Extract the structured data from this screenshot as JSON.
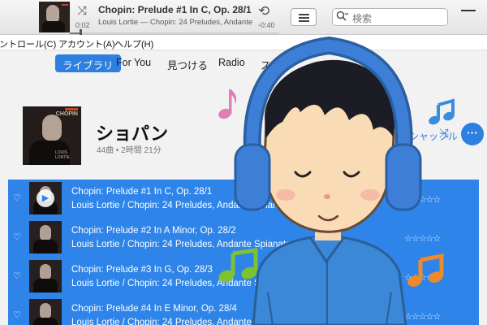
{
  "player": {
    "title": "Chopin: Prelude #1 In C, Op. 28/1",
    "subtitle": "Louis Lortie — Chopin: 24 Preludes, Andante Spianato",
    "elapsed": "0:02",
    "remaining": "-0:40",
    "progress_fraction": 0.05,
    "shuffle_icon": "⤨",
    "repeat_icon": "⟲"
  },
  "search": {
    "placeholder": "検索",
    "icon": "magnifier"
  },
  "menubar": {
    "items": [
      "コントロール(C)",
      "アカウント(A)",
      "ヘルプ(H)"
    ]
  },
  "nav": {
    "tabs": [
      {
        "label": "ライブラリ",
        "active": true
      },
      {
        "label": "For You",
        "active": false
      },
      {
        "label": "見つける",
        "active": false
      },
      {
        "label": "Radio",
        "active": false
      },
      {
        "label": "ストア",
        "active": false
      }
    ]
  },
  "album": {
    "title": "ショパン",
    "meta": "44曲 • 2時間 21分",
    "shuffle_label": "シャッフル",
    "art_text": "CHOPIN",
    "art_caption": "LOUIS LORTIE",
    "more_label": "···"
  },
  "tracks": [
    {
      "title": "Chopin: Prelude #1 In C, Op. 28/1",
      "subtitle": "Louis Lortie / Chopin: 24 Preludes, Andante Spianato",
      "playing": true,
      "stars": "☆☆☆☆☆"
    },
    {
      "title": "Chopin: Prelude #2 In A Minor, Op. 28/2",
      "subtitle": "Louis Lortie / Chopin: 24 Preludes, Andante Spianato, Etc",
      "playing": false,
      "stars": "☆☆☆☆☆"
    },
    {
      "title": "Chopin: Prelude #3 In G, Op. 28/3",
      "subtitle": "Louis Lortie / Chopin: 24 Preludes, Andante Spianato",
      "playing": false,
      "stars": "☆☆☆☆☆"
    },
    {
      "title": "Chopin: Prelude #4 In E Minor, Op. 28/4",
      "subtitle": "Louis Lortie / Chopin: 24 Preludes, Andante Spianato",
      "playing": false,
      "stars": "☆☆☆☆☆"
    }
  ],
  "colors": {
    "accent": "#2d7fe0",
    "selection": "#2e84e8",
    "headphones": "#3d7fd6",
    "note_pink": "#e07fb6",
    "note_blue": "#3a8ddd",
    "note_green": "#7cc231",
    "note_orange": "#ef8a2a"
  },
  "illustration": {
    "subject": "boy-with-headphones",
    "notes": [
      "note-pink",
      "note-blue",
      "note-green",
      "note-orange"
    ]
  }
}
